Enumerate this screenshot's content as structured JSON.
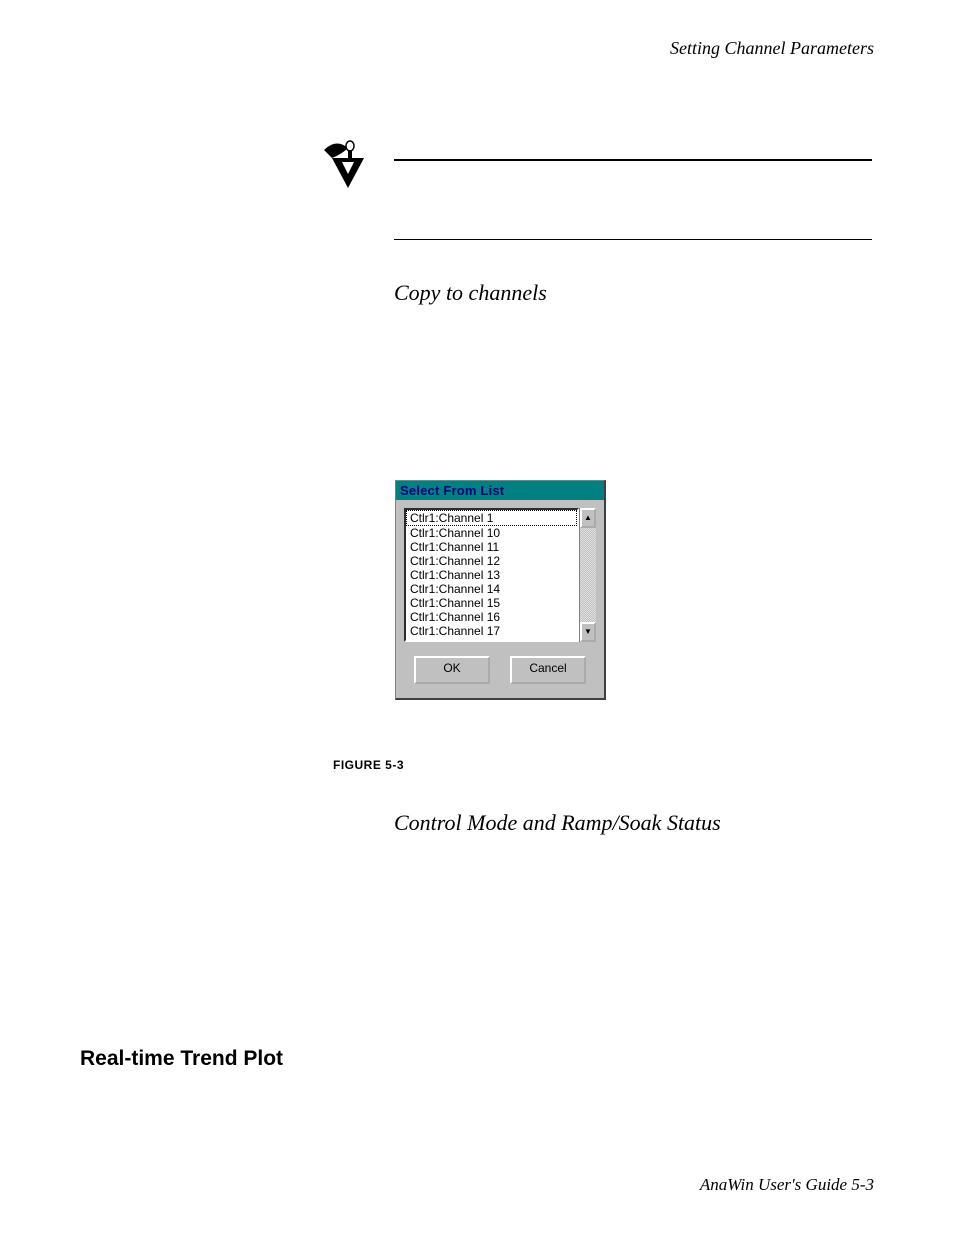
{
  "running_head": "Setting Channel Parameters",
  "subhead1": "Copy to channels",
  "dialog": {
    "title": "Select From List",
    "items": [
      "Ctlr1:Channel 1",
      "Ctlr1:Channel 10",
      "Ctlr1:Channel 11",
      "Ctlr1:Channel 12",
      "Ctlr1:Channel 13",
      "Ctlr1:Channel 14",
      "Ctlr1:Channel 15",
      "Ctlr1:Channel 16",
      "Ctlr1:Channel 17"
    ],
    "ok_label": "OK",
    "cancel_label": "Cancel",
    "scroll_up_glyph": "▲",
    "scroll_down_glyph": "▼"
  },
  "figure_label": "FIGURE 5-3",
  "subhead2": "Control Mode and Ramp/Soak Status",
  "section_head": "Real-time Trend Plot",
  "footer": "AnaWin User's Guide  5-3"
}
